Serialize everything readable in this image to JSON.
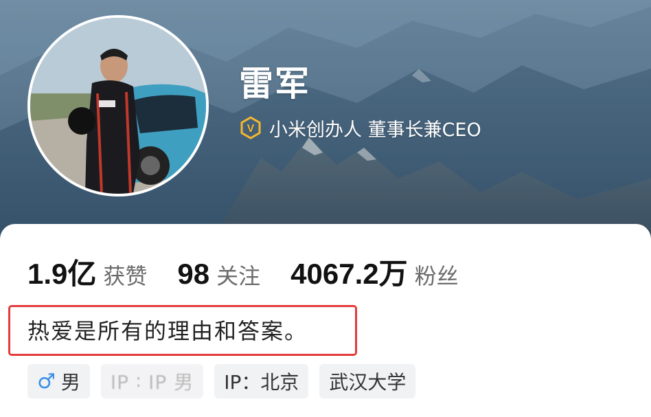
{
  "profile": {
    "name": "雷军",
    "verification_text": "小米创办人 董事长兼CEO",
    "verify_icon_letter": "V",
    "bio": "热爱是所有的理由和答案。"
  },
  "stats": [
    {
      "value": "1.9亿",
      "label": "获赞"
    },
    {
      "value": "98",
      "label": "关注"
    },
    {
      "value": "4067.2万",
      "label": "粉丝"
    }
  ],
  "tags": {
    "gender_icon": "♂",
    "gender": "男",
    "ghost": "IP ∶ IP 男",
    "ip": "IP：北京",
    "school": "武汉大学"
  },
  "colors": {
    "highlight_border": "#e53a3a",
    "verify_gold": "#f5b82e",
    "male_icon": "#3b8ee8",
    "tag_bg": "#f1f2f4"
  }
}
